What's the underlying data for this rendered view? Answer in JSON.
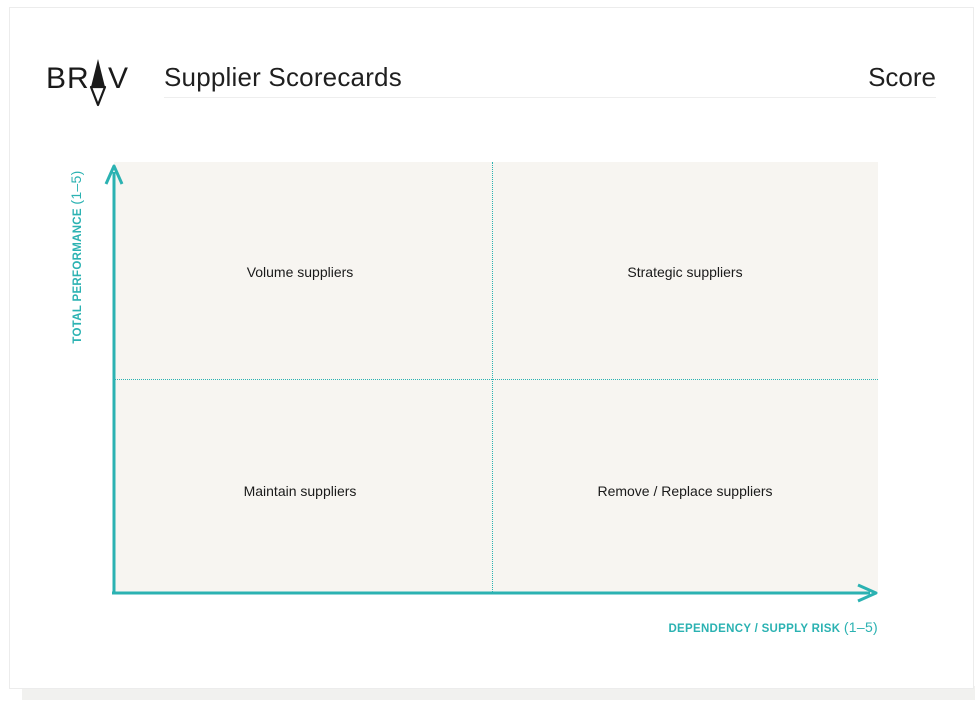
{
  "header": {
    "logo_text": "BRAV",
    "title": "Supplier Scorecards",
    "right_label": "Score"
  },
  "matrix": {
    "y_axis": {
      "label": "TOTAL PERFORMANCE",
      "unit": "(1–5)"
    },
    "x_axis": {
      "label": "DEPENDENCY / SUPPLY RISK",
      "unit": "(1–5)"
    },
    "quadrants": {
      "top_left": "Volume suppliers",
      "top_right": "Strategic suppliers",
      "bottom_left": "Maintain suppliers",
      "bottom_right": "Remove / Replace suppliers"
    }
  },
  "colors": {
    "accent": "#2bb2b2",
    "quadrant_bg": "#f7f5f1",
    "text": "#1a1a1a"
  }
}
